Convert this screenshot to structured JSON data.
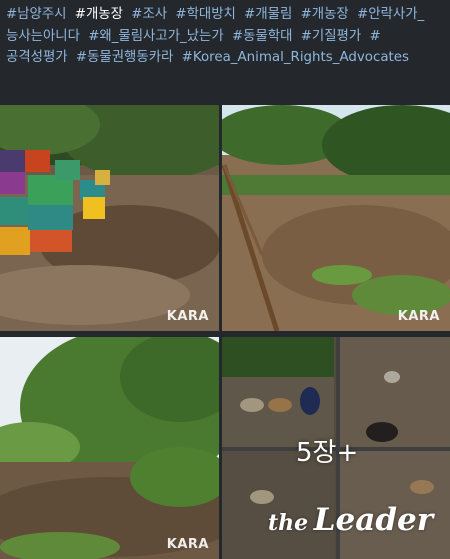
{
  "hashtags": [
    {
      "text": "#남양주시",
      "highlight": false
    },
    {
      "text": "#개농장",
      "highlight": true
    },
    {
      "text": "#조사",
      "highlight": false
    },
    {
      "text": "#학대방치",
      "highlight": false
    },
    {
      "text": "#개물림",
      "highlight": false
    },
    {
      "text": "#개농장",
      "highlight": false
    },
    {
      "text": "#안락사가_능사는아니다",
      "highlight": false
    },
    {
      "text": "#왜_물림사고가_났는가",
      "highlight": false
    },
    {
      "text": "#동물학대",
      "highlight": false
    },
    {
      "text": "#기질평가",
      "highlight": false
    },
    {
      "text": "#공격성평가",
      "highlight": false
    },
    {
      "text": "#동물권행동카라",
      "highlight": false
    },
    {
      "text": "#Korea_Animal_Rights_Advocates",
      "highlight": false
    }
  ],
  "photos": [
    {
      "watermark": "KARA",
      "subject": "stacked-crates"
    },
    {
      "watermark": "KARA",
      "subject": "dirt-yard-fence"
    },
    {
      "watermark": "KARA",
      "subject": "hillside-trees"
    },
    {
      "watermark": "",
      "subject": "dogs-collage"
    }
  ],
  "more_label": "5장+",
  "brand": {
    "the": "the",
    "name": "Leader"
  },
  "colors": {
    "hashtag": "#8fb7de",
    "highlight": "#ffffff",
    "background": "#24272b"
  }
}
